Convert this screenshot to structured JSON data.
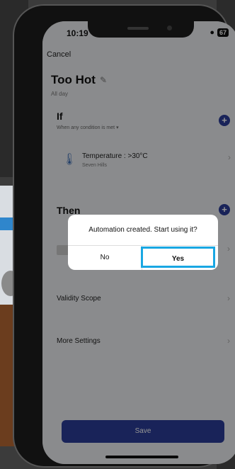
{
  "status": {
    "time": "10:19",
    "battery": "67"
  },
  "nav": {
    "cancel_label": "Cancel"
  },
  "automation": {
    "title": "Too Hot",
    "schedule": "All day"
  },
  "if_section": {
    "title": "If",
    "condition_mode": "When any condition is met",
    "condition": {
      "title": "Temperature : >30°C",
      "location": "Seven Hills"
    }
  },
  "then_section": {
    "title": "Then"
  },
  "settings": {
    "validity": "Validity Scope",
    "more": "More Settings"
  },
  "save_label": "Save",
  "dialog": {
    "message": "Automation created. Start using it?",
    "no_label": "No",
    "yes_label": "Yes"
  },
  "colors": {
    "accent": "#2b3d9a",
    "highlight": "#19a7e3"
  }
}
